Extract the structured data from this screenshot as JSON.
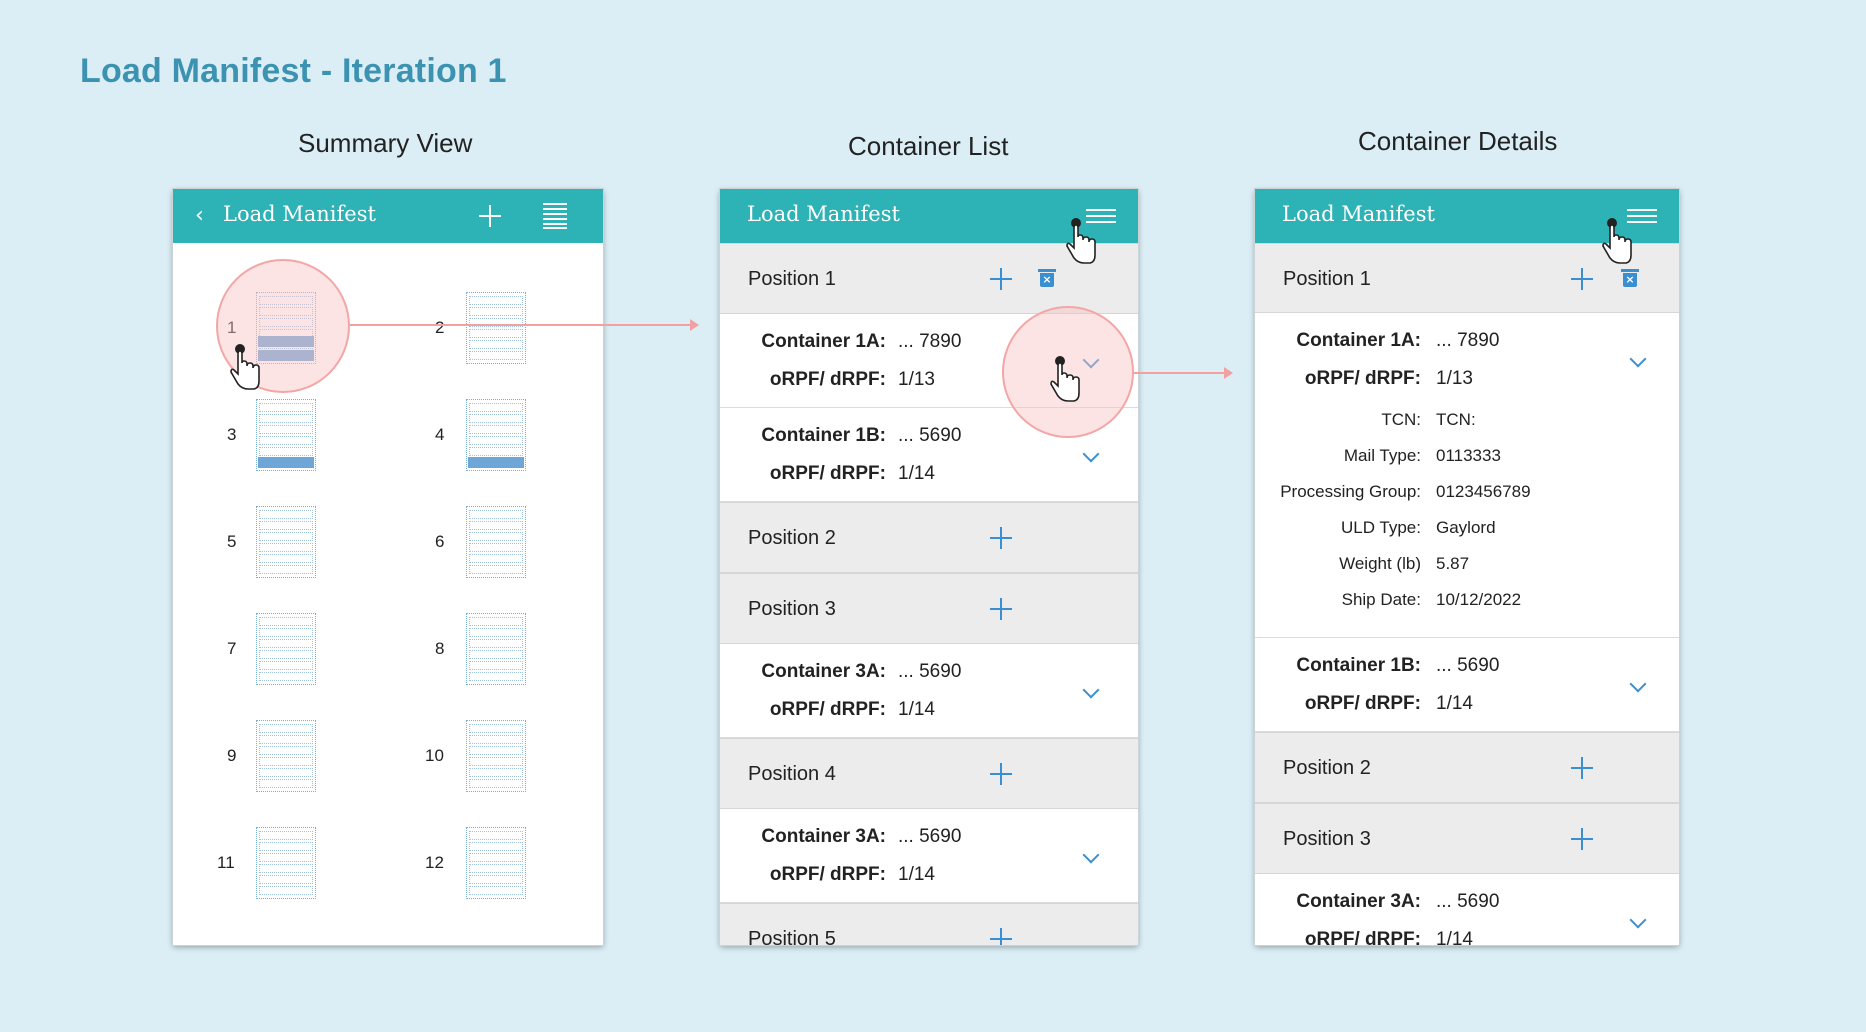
{
  "page_title": "Load Manifest - Iteration 1",
  "captions": {
    "summary": "Summary View",
    "list": "Container List",
    "details": "Container Details"
  },
  "colors": {
    "background": "#dbeef6",
    "app_bar": "#2db2b5",
    "accent_blue": "#3b8fd0",
    "title": "#3b93b1",
    "highlight": "#f3a6a6"
  },
  "summary_view": {
    "back_icon": "chevron-left-icon",
    "title": "Load Manifest",
    "add_icon": "plus-icon",
    "list_icon": "list-view-icon",
    "slots": [
      {
        "label": "1",
        "filled_rows": 2
      },
      {
        "label": "2",
        "filled_rows": 0
      },
      {
        "label": "3",
        "filled_rows": 1
      },
      {
        "label": "4",
        "filled_rows": 1
      },
      {
        "label": "5",
        "filled_rows": 0
      },
      {
        "label": "6",
        "filled_rows": 0
      },
      {
        "label": "7",
        "filled_rows": 0
      },
      {
        "label": "8",
        "filled_rows": 0
      },
      {
        "label": "9",
        "filled_rows": 0
      },
      {
        "label": "10",
        "filled_rows": 0
      },
      {
        "label": "11",
        "filled_rows": 0
      },
      {
        "label": "12",
        "filled_rows": 0
      }
    ]
  },
  "container_list": {
    "title": "Load Manifest",
    "menu_icon": "menu-icon",
    "rows": [
      {
        "kind": "position",
        "label": "Position 1",
        "has_delete": true
      },
      {
        "kind": "container",
        "name_label": "Container 1A:",
        "name_value": "... 7890",
        "rpf_label": "oRPF/ dRPF:",
        "rpf_value": "1/13"
      },
      {
        "kind": "container",
        "name_label": "Container 1B:",
        "name_value": "... 5690",
        "rpf_label": "oRPF/ dRPF:",
        "rpf_value": "1/14"
      },
      {
        "kind": "position",
        "label": "Position 2",
        "has_delete": false
      },
      {
        "kind": "position",
        "label": "Position 3",
        "has_delete": false
      },
      {
        "kind": "container",
        "name_label": "Container 3A:",
        "name_value": "... 5690",
        "rpf_label": "oRPF/ dRPF:",
        "rpf_value": "1/14"
      },
      {
        "kind": "position",
        "label": "Position 4",
        "has_delete": false
      },
      {
        "kind": "container",
        "name_label": "Container 3A:",
        "name_value": "... 5690",
        "rpf_label": "oRPF/ dRPF:",
        "rpf_value": "1/14"
      },
      {
        "kind": "position",
        "label": "Position 5",
        "has_delete": false
      }
    ]
  },
  "container_details": {
    "title": "Load Manifest",
    "menu_icon": "menu-icon",
    "position1": "Position 1",
    "container_1a": {
      "name_label": "Container 1A:",
      "name_value": "... 7890",
      "rpf_label": "oRPF/ dRPF:",
      "rpf_value": "1/13"
    },
    "details": [
      {
        "label": "TCN:",
        "value": "TCN:"
      },
      {
        "label": "Mail Type:",
        "value": "0113333"
      },
      {
        "label": "Processing Group:",
        "value": "0123456789"
      },
      {
        "label": "ULD Type:",
        "value": "Gaylord"
      },
      {
        "label": "Weight (lb)",
        "value": "5.87"
      },
      {
        "label": "Ship Date:",
        "value": "10/12/2022"
      }
    ],
    "container_1b": {
      "name_label": "Container 1B:",
      "name_value": "... 5690",
      "rpf_label": "oRPF/ dRPF:",
      "rpf_value": "1/14"
    },
    "position2": "Position 2",
    "position3": "Position 3",
    "container_3a": {
      "name_label": "Container 3A:",
      "name_value": "... 5690",
      "rpf_label": "oRPF/ dRPF:",
      "rpf_value": "1/14"
    }
  }
}
